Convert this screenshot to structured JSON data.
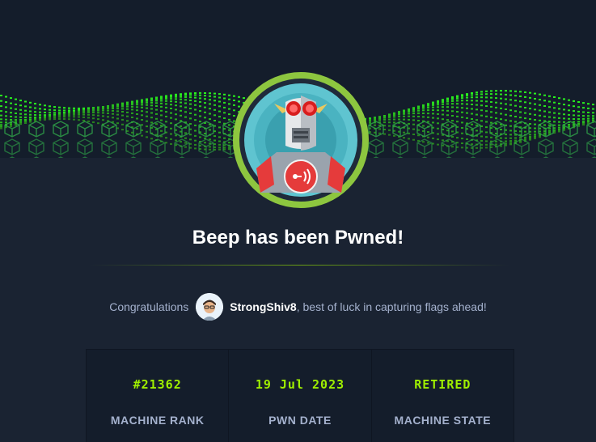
{
  "heading": "Beep has been Pwned!",
  "congrats": {
    "prefix": "Congratulations",
    "username": "StrongShiv8",
    "suffix": ", best of luck in capturing flags ahead!"
  },
  "stats": [
    {
      "value": "#21362",
      "label": "MACHINE RANK"
    },
    {
      "value": "19 Jul 2023",
      "label": "PWN DATE"
    },
    {
      "value": "RETIRED",
      "label": "MACHINE STATE"
    }
  ],
  "colors": {
    "accent": "#9fef00",
    "background": "#1a2332",
    "panel": "#141d2b"
  },
  "icons": {
    "machine_avatar": "robot-machine-avatar",
    "user_avatar": "user-avatar"
  }
}
